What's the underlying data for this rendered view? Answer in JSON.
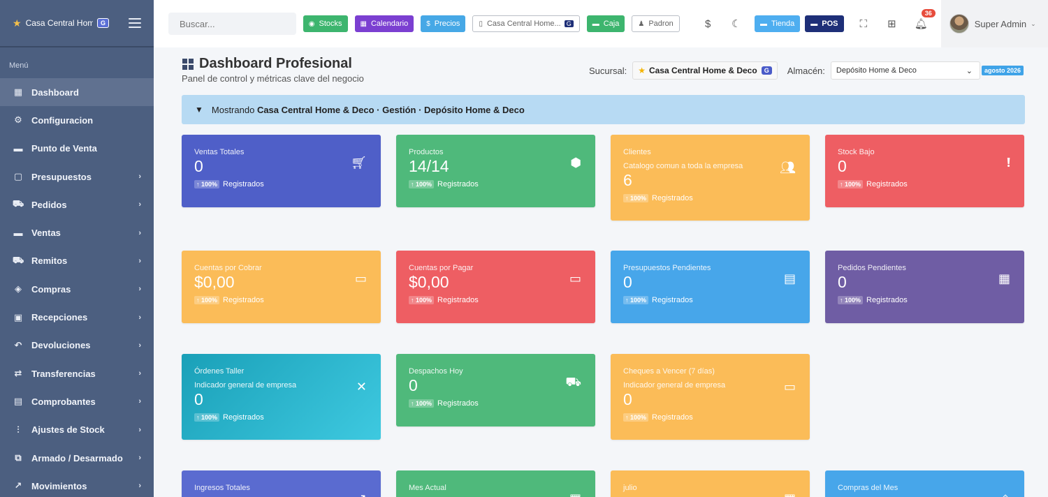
{
  "sidebar": {
    "brand": "Casa Central Hom...",
    "brand_badge": "G",
    "menu_header": "Menú",
    "items": [
      {
        "label": "Dashboard",
        "icon": "dashboard-icon",
        "glyph": "▦"
      },
      {
        "label": "Configuracion",
        "icon": "gear-icon",
        "glyph": "⚙"
      },
      {
        "label": "Punto de Venta",
        "icon": "cash-register-icon",
        "glyph": "▬"
      },
      {
        "label": "Presupuestos",
        "icon": "file-icon",
        "glyph": "▢"
      },
      {
        "label": "Pedidos",
        "icon": "cart-icon",
        "glyph": "⛟"
      },
      {
        "label": "Ventas",
        "icon": "cash-register-icon",
        "glyph": "▬"
      },
      {
        "label": "Remitos",
        "icon": "truck-icon",
        "glyph": "⛟"
      },
      {
        "label": "Compras",
        "icon": "box-icon",
        "glyph": "◈"
      },
      {
        "label": "Recepciones",
        "icon": "inbox-icon",
        "glyph": "▣"
      },
      {
        "label": "Devoluciones",
        "icon": "undo-icon",
        "glyph": "↶"
      },
      {
        "label": "Transferencias",
        "icon": "exchange-icon",
        "glyph": "⇄"
      },
      {
        "label": "Comprobantes",
        "icon": "receipt-icon",
        "glyph": "▤"
      },
      {
        "label": "Ajustes de Stock",
        "icon": "sliders-icon",
        "glyph": "⫶"
      },
      {
        "label": "Armado / Desarmado",
        "icon": "clone-icon",
        "glyph": "⧉"
      },
      {
        "label": "Movimientos",
        "icon": "chart-line-icon",
        "glyph": "↗"
      }
    ]
  },
  "topbar": {
    "search_placeholder": "Buscar...",
    "stocks": "Stocks",
    "calendario": "Calendario",
    "precios": "Precios",
    "sucursal_select": "Casa Central Home...",
    "sucursal_badge": "G",
    "caja": "Caja",
    "padron": "Padron",
    "tienda": "Tienda",
    "pos": "POS",
    "notifications_count": "36",
    "user_name": "Super Admin"
  },
  "header": {
    "title": "Dashboard Profesional",
    "subtitle": "Panel de control y métricas clave del negocio",
    "sucursal_label": "Sucursal:",
    "sucursal_value": "Casa Central Home & Deco",
    "sucursal_badge": "G",
    "almacen_label": "Almacén:",
    "almacen_value": "Depósito Home & Deco",
    "date_badge": "agosto 2026"
  },
  "infobar": {
    "prefix": "Mostrando",
    "context": "Casa Central Home & Deco · Gestión · Depósito Home & Deco"
  },
  "cards": [
    {
      "label": "Ventas Totales",
      "value": "0",
      "pill": "↑ 100%",
      "foot": "Registrados",
      "icon": "cart-icon",
      "color": "#4f5fc8"
    },
    {
      "label": "Productos",
      "value": "14/14",
      "pill": "↑ 100%",
      "foot": "Registrados",
      "icon": "cube-icon",
      "color": "#4fb97b"
    },
    {
      "label": "Clientes",
      "sub": "Catalogo comun a toda la empresa",
      "value": "6",
      "pill": "↑ 100%",
      "foot": "Registrados",
      "icon": "users-icon",
      "color": "#fbbc58"
    },
    {
      "label": "Stock Bajo",
      "value": "0",
      "pill": "↑ 100%",
      "foot": "Registrados",
      "icon": "exclamation-icon",
      "color": "#ee5e63"
    },
    {
      "label": "Cuentas por Cobrar",
      "value": "$0,00",
      "pill": "↑ 100%",
      "foot": "Registrados",
      "icon": "money-bill-icon",
      "color": "#fbbc58"
    },
    {
      "label": "Cuentas por Pagar",
      "value": "$0,00",
      "pill": "↑ 100%",
      "foot": "Registrados",
      "icon": "money-check-icon",
      "color": "#ee5e63"
    },
    {
      "label": "Presupuestos Pendientes",
      "value": "0",
      "pill": "↑ 100%",
      "foot": "Registrados",
      "icon": "file-icon",
      "color": "#47a6ea"
    },
    {
      "label": "Pedidos Pendientes",
      "value": "0",
      "pill": "↑ 100%",
      "foot": "Registrados",
      "icon": "clipboard-icon",
      "color": "#6f5da4"
    },
    {
      "label": "Órdenes Taller",
      "sub": "Indicador general de empresa",
      "value": "0",
      "pill": "↑ 100%",
      "foot": "Registrados",
      "icon": "tools-icon",
      "color": "#1aa0b8"
    },
    {
      "label": "Despachos Hoy",
      "value": "0",
      "pill": "↑ 100%",
      "foot": "Registrados",
      "icon": "truck-icon",
      "color": "#4fb97b"
    },
    {
      "label": "Cheques a Vencer (7 días)",
      "sub": "Indicador general de empresa",
      "value": "0",
      "pill": "↑ 100%",
      "foot": "Registrados",
      "icon": "card-icon",
      "color": "#fbbc58"
    },
    {
      "label": "Ingresos Totales",
      "icon": "chart-up-icon",
      "color": "#5a6bd0"
    },
    {
      "label": "Mes Actual",
      "icon": "calendar-icon",
      "color": "#4fb97b"
    },
    {
      "label": "julio",
      "icon": "calendar-icon",
      "color": "#fbbc58"
    },
    {
      "label": "Compras del Mes",
      "icon": "bag-icon",
      "color": "#47a6ea"
    }
  ]
}
